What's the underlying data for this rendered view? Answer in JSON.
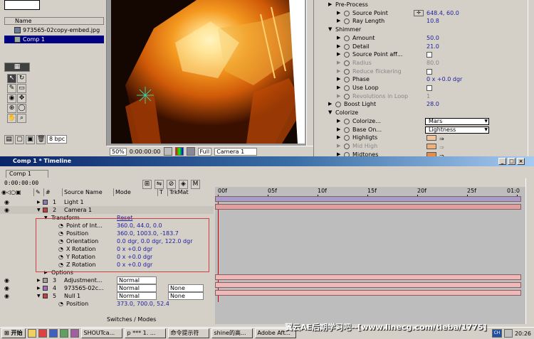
{
  "project": {
    "name_header": "Name",
    "items": [
      {
        "label": "973565-02copy-embed.jpg",
        "selected": false
      },
      {
        "label": "Comp 1",
        "selected": true
      }
    ],
    "bpc": "8 bpc"
  },
  "viewer": {
    "zoom": "50%",
    "timecode": "0:00:00:00",
    "resolution": "Full",
    "camera": "Camera 1"
  },
  "effects": {
    "rows": [
      {
        "indent": 1,
        "type": "group",
        "label": "Pre-Process"
      },
      {
        "indent": 2,
        "type": "value",
        "label": "Source Point",
        "value": "648.4, 60.0",
        "icon": "crosshair"
      },
      {
        "indent": 2,
        "type": "value",
        "label": "Ray Length",
        "value": "10.8"
      },
      {
        "indent": 1,
        "type": "group-open",
        "label": "Shimmer"
      },
      {
        "indent": 2,
        "type": "value",
        "label": "Amount",
        "value": "50.0"
      },
      {
        "indent": 2,
        "type": "value",
        "label": "Detail",
        "value": "21.0"
      },
      {
        "indent": 2,
        "type": "check",
        "label": "Source Point aff...",
        "value": ""
      },
      {
        "indent": 2,
        "type": "value",
        "label": "Radius",
        "value": "80.0",
        "dim": true
      },
      {
        "indent": 2,
        "type": "check",
        "label": "Reduce flickering",
        "value": "",
        "dim": true
      },
      {
        "indent": 2,
        "type": "value",
        "label": "Phase",
        "value": "0 x +0.0 dgr"
      },
      {
        "indent": 2,
        "type": "check",
        "label": "Use Loop",
        "value": ""
      },
      {
        "indent": 2,
        "type": "value",
        "label": "Revolutions in Loop",
        "value": "1",
        "dim": true
      },
      {
        "indent": 1,
        "type": "value",
        "label": "Boost Light",
        "value": "28.0"
      },
      {
        "indent": 1,
        "type": "group-open",
        "label": "Colorize"
      },
      {
        "indent": 2,
        "type": "dropdown",
        "label": "Colorize...",
        "value": "Mars"
      },
      {
        "indent": 2,
        "type": "dropdown",
        "label": "Base On...",
        "value": "Lightness"
      },
      {
        "indent": 2,
        "type": "color",
        "label": "Highligts",
        "value": "",
        "color": "#f4c49a"
      },
      {
        "indent": 2,
        "type": "color",
        "label": "Mid High",
        "value": "",
        "color": "#f0b07a",
        "dim": true
      },
      {
        "indent": 2,
        "type": "color",
        "label": "Midtones",
        "value": "",
        "color": "#e88c4a"
      }
    ]
  },
  "timeline": {
    "title": "Comp 1 * Timeline",
    "tab": "Comp 1",
    "timecode": "0:00:00:00",
    "columns": {
      "num": "#",
      "source": "Source Name",
      "mode": "Mode",
      "t": "T",
      "trkmat": "TrkMat"
    },
    "ruler": [
      "00f",
      "05f",
      "10f",
      "15f",
      "20f",
      "25f",
      "01:0"
    ],
    "layers": [
      {
        "kind": "layer",
        "num": "1",
        "name": "Light 1",
        "color": "#8a7ab8",
        "mode": "",
        "trkmat": "",
        "bar": "#a89ccc"
      },
      {
        "kind": "layer",
        "num": "2",
        "name": "Camera 1",
        "color": "#c04040",
        "mode": "",
        "trkmat": "",
        "bar": "#e0a0a0",
        "open": true
      },
      {
        "kind": "group",
        "name": "Transform",
        "value": "Reset"
      },
      {
        "kind": "prop",
        "name": "Point of Int...",
        "value": "360.0, 44.0, 0.0"
      },
      {
        "kind": "prop",
        "name": "Position",
        "value": "360.0, 1003.0, -183.7"
      },
      {
        "kind": "prop",
        "name": "Orientation",
        "value": "0.0 dgr, 0.0 dgr, 122.0 dgr"
      },
      {
        "kind": "prop",
        "name": "X Rotation",
        "value": "0 x +0.0 dgr"
      },
      {
        "kind": "prop",
        "name": "Y Rotation",
        "value": "0 x +0.0 dgr"
      },
      {
        "kind": "prop",
        "name": "Z Rotation",
        "value": "0 x +0.0 dgr"
      },
      {
        "kind": "options",
        "name": "Options"
      },
      {
        "kind": "layer",
        "num": "3",
        "name": "Adjustment...",
        "color": "#a0a0a0",
        "mode": "Normal",
        "trkmat": "",
        "bar": "#f0b8b8"
      },
      {
        "kind": "layer",
        "num": "4",
        "name": "973565-02c...",
        "color": "#a070c0",
        "mode": "Normal",
        "trkmat": "None",
        "bar": "#f0b8b8"
      },
      {
        "kind": "layer",
        "num": "5",
        "name": "Null 1",
        "color": "#c04040",
        "mode": "Normal",
        "trkmat": "None",
        "bar": "#f0b8b8",
        "open": true
      },
      {
        "kind": "prop",
        "name": "Position",
        "value": "373.0, 700.0, 52.4"
      }
    ],
    "footer": "Switches / Modes"
  },
  "taskbar": {
    "start": "开始",
    "tasks": [
      "SHOUTca...",
      "p *** 1. ...",
      "命令提示符",
      "shine的高...",
      "Adobe Aft..."
    ],
    "tray": [
      "CH"
    ],
    "clock": "20:26"
  },
  "watermark": "翼云AE后期学习吧--[www.linecg.com/tieba/1775]"
}
